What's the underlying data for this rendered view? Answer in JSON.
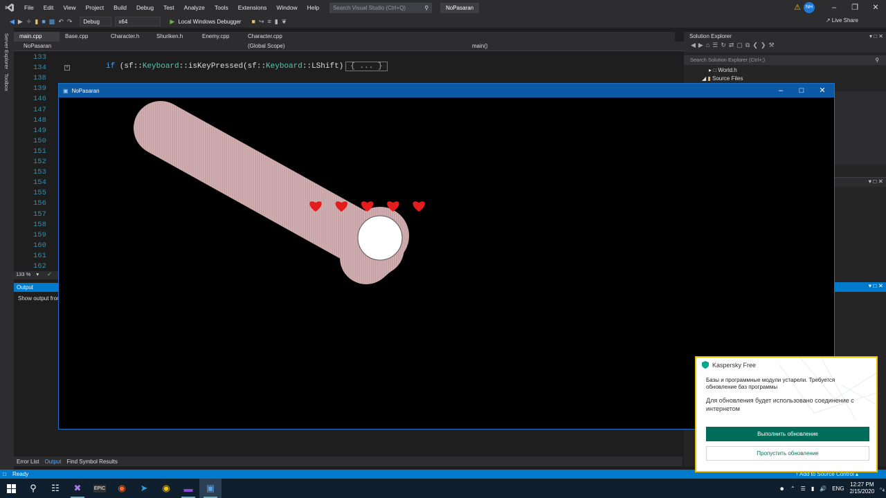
{
  "menu": {
    "items": [
      "File",
      "Edit",
      "View",
      "Project",
      "Build",
      "Debug",
      "Test",
      "Analyze",
      "Tools",
      "Extensions",
      "Window",
      "Help"
    ],
    "search_placeholder": "Search Visual Studio (Ctrl+Q)",
    "solution_name": "NoPasaran",
    "user_initials": "NH"
  },
  "toolbar": {
    "config": "Debug",
    "platform": "x64",
    "debugger": "Local Windows Debugger",
    "live_share": "Live Share"
  },
  "side_tools": [
    "Server Explorer",
    "Toolbox"
  ],
  "editor": {
    "tabs": [
      "main.cpp",
      "Base.cpp",
      "Character.h",
      "Shuriken.h",
      "Enemy.cpp",
      "Character.cpp"
    ],
    "nav_project": "NoPasaran",
    "nav_scope": "(Global Scope)",
    "nav_member": "main()",
    "line_numbers": [
      "133",
      "134",
      "138",
      "139",
      "146",
      "147",
      "148",
      "149",
      "150",
      "151",
      "152",
      "153",
      "154",
      "155",
      "156",
      "157",
      "158",
      "159",
      "160",
      "161",
      "162"
    ],
    "code": {
      "kw_if": "if",
      "p1": " (sf::",
      "t1": "Keyboard",
      "p2": "::isKeyPressed(sf::",
      "t2": "Keyboard",
      "p3": "::LShift)",
      "collapsed": "{ ... }"
    },
    "zoom": "133 %"
  },
  "output_panel": {
    "title": "Output",
    "show_output_from": "Show output from:",
    "bottom_tabs": [
      "Error List",
      "Output",
      "Find Symbol Results"
    ]
  },
  "solution_explorer": {
    "title": "Solution Explorer",
    "search_placeholder": "Search Solution Explorer (Ctrl+;)",
    "items": [
      "World.h",
      "Source Files"
    ]
  },
  "game_window": {
    "title": "NoPasaran",
    "lives": 5,
    "heart_color": "#e41c1c",
    "trail_color": "#c7a3a6"
  },
  "status_bar": {
    "ready": "Ready",
    "add_source_control": "Add to Source Control"
  },
  "kaspersky": {
    "app": "Kaspersky Free",
    "message": "Базы и программные модули устарели. Требуется обновление баз программы",
    "detail": "Для обновления будет использовано соединение с интернетом",
    "primary_button": "Выполнить обновление",
    "secondary_button": "Пропустить обновление",
    "accent_color": "#006d5b"
  },
  "taskbar": {
    "language": "ENG",
    "time": "12:27 PM",
    "date": "2/15/2020",
    "notification_count": "4"
  }
}
